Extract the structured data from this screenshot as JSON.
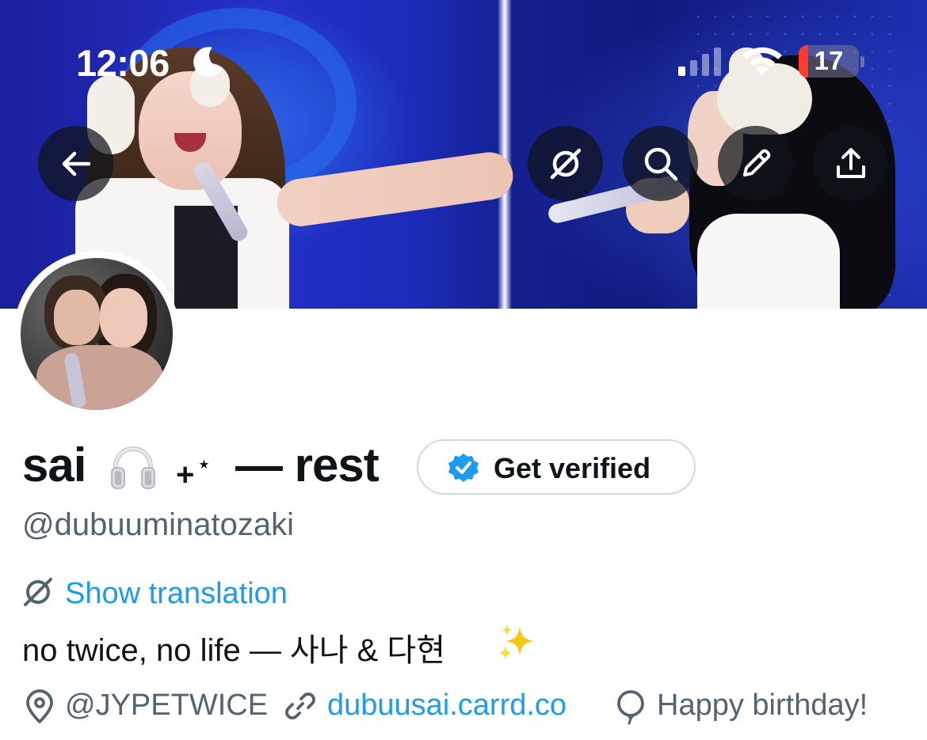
{
  "status_bar": {
    "time": "12:06",
    "battery": "17"
  },
  "header": {
    "back_icon": "arrow-left-icon",
    "actions": [
      "translate-icon",
      "search-icon",
      "edit-icon",
      "share-icon"
    ]
  },
  "profile": {
    "name_prefix": "sai",
    "name_emoji": "headphones-icon",
    "name_deco": "+",
    "name_deco_star": "⋆",
    "name_suffix": "— rest",
    "verify_button": "Get verified",
    "handle": "@dubuuminatozaki",
    "show_translation": "Show translation",
    "bio": "no twice, no life — 사나 & 다현",
    "bio_emoji": "sparkles-icon",
    "location": "@JYPETWICE",
    "link": "dubuusai.carrd.co",
    "birthday": "Happy birthday!"
  },
  "colors": {
    "accent": "#1d9bf0",
    "secondary_text": "#536471",
    "primary_text": "#0f1419",
    "banner_blue": "#1c2bb8",
    "battery_low": "#ff3b30"
  }
}
